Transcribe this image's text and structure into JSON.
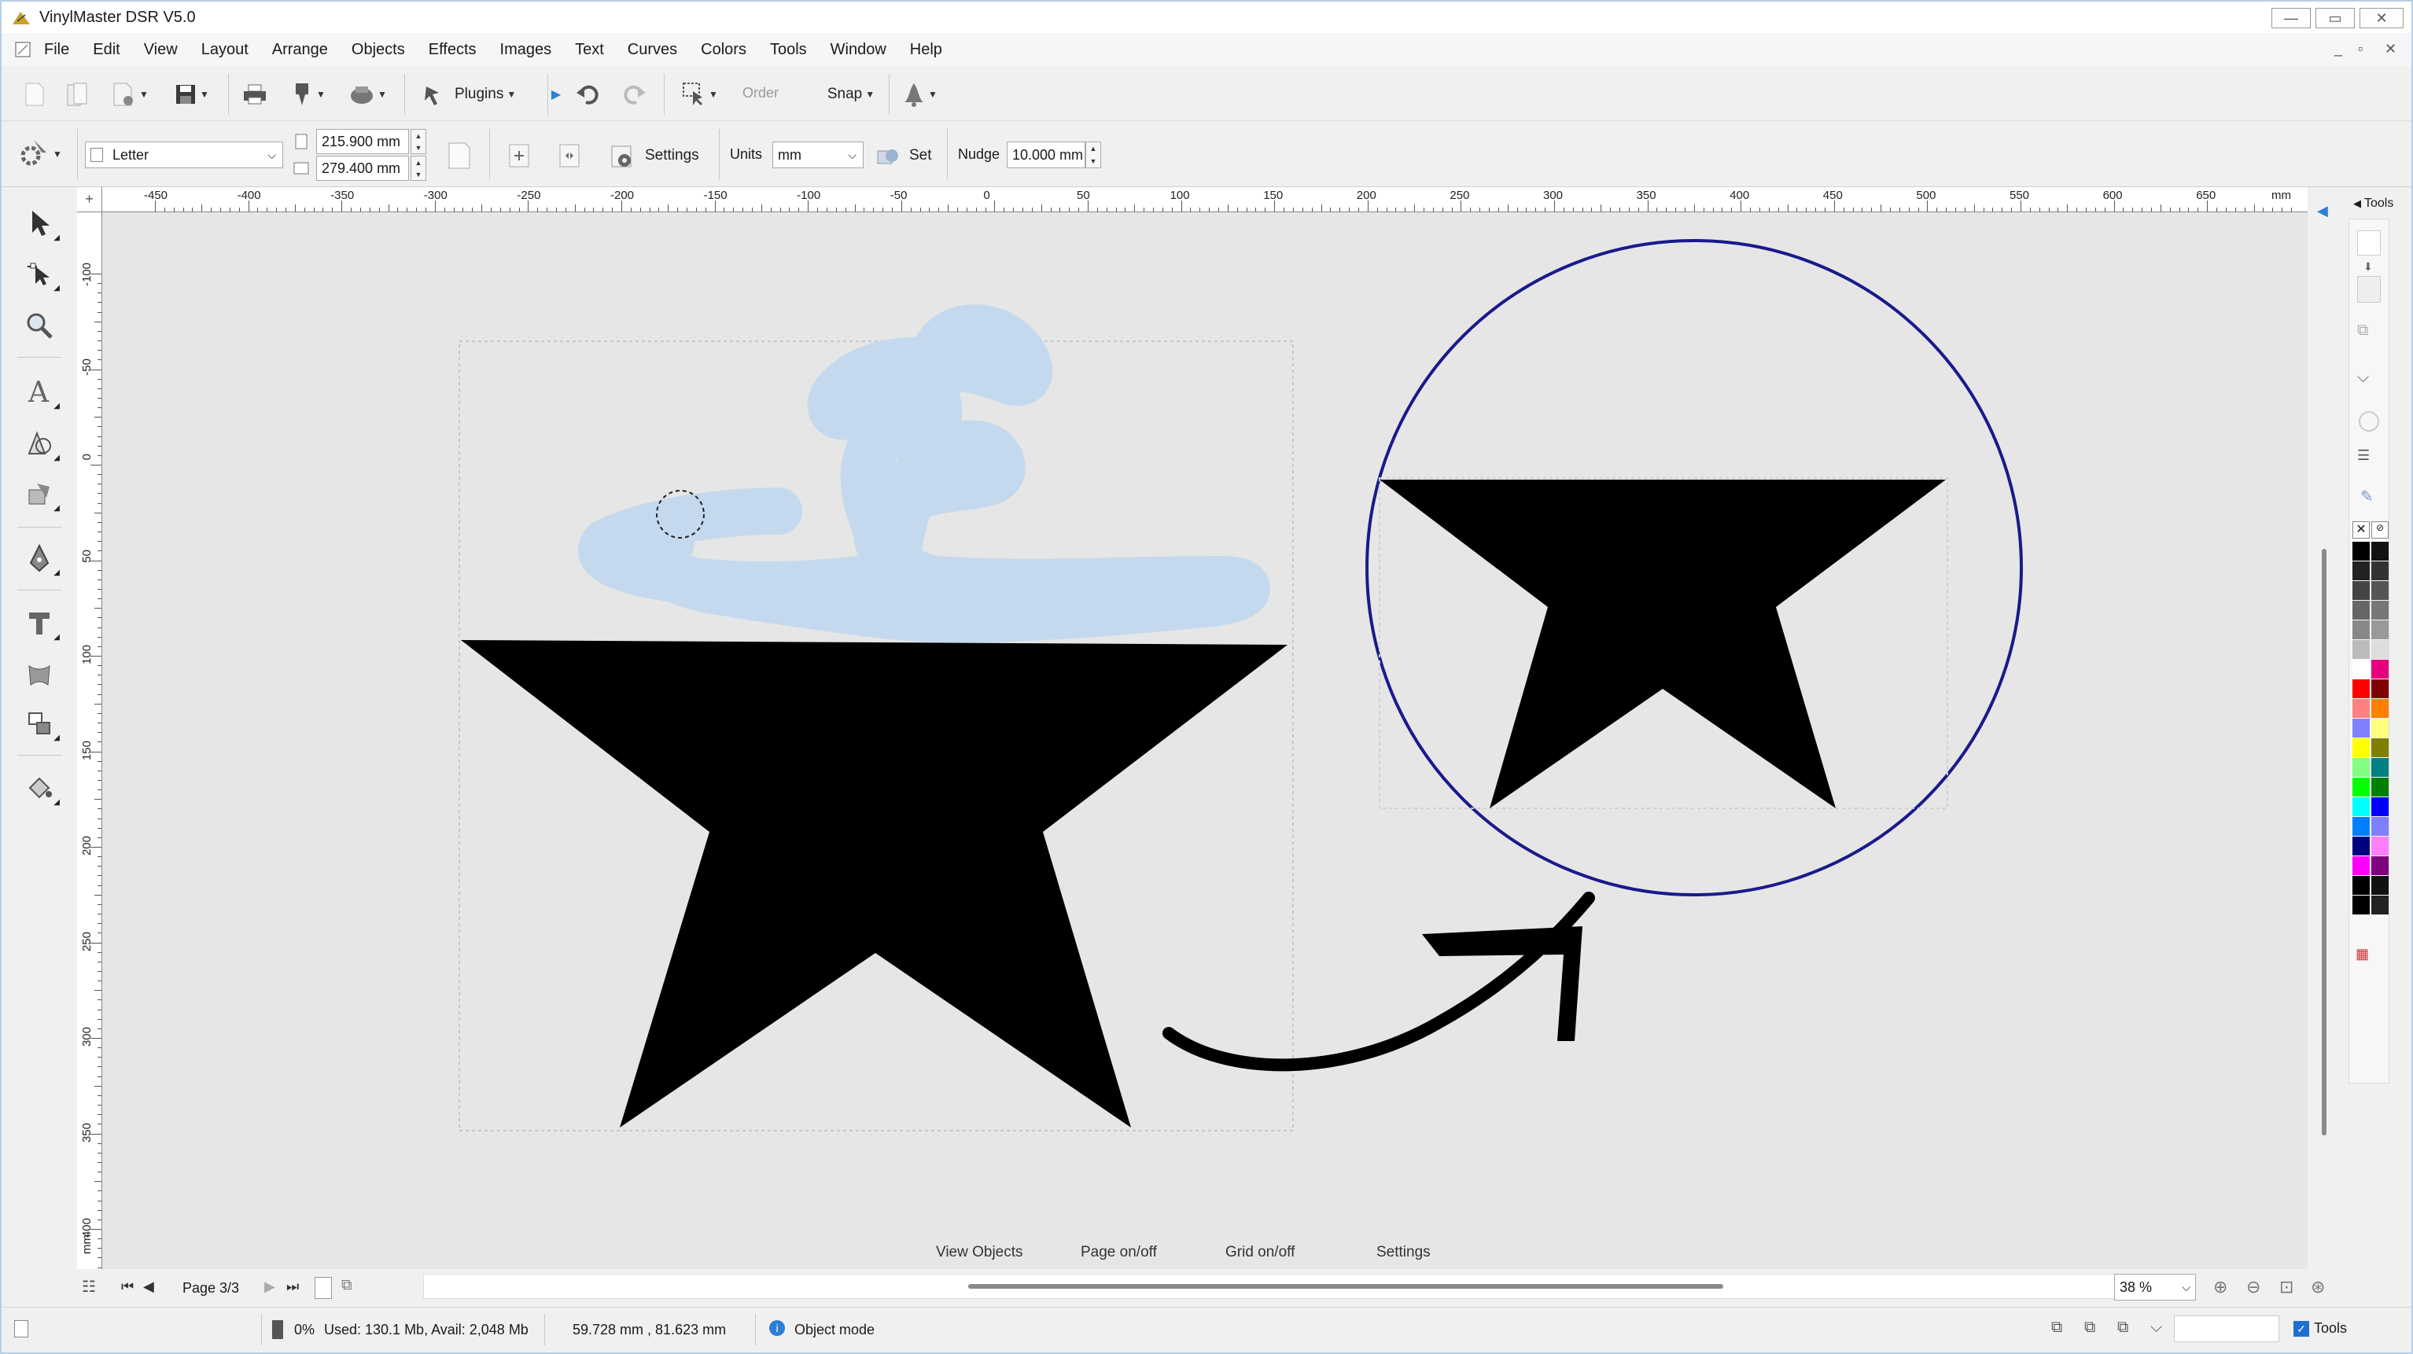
{
  "window": {
    "title": "VinylMaster DSR V5.0",
    "controls": [
      "minimize",
      "maximize",
      "close"
    ]
  },
  "menu": [
    "File",
    "Edit",
    "View",
    "Layout",
    "Arrange",
    "Objects",
    "Effects",
    "Images",
    "Text",
    "Curves",
    "Colors",
    "Tools",
    "Window",
    "Help"
  ],
  "toolbar": {
    "plugins_label": "Plugins",
    "order_label": "Order",
    "snap_label": "Snap"
  },
  "page_setup": {
    "page_size": "Letter",
    "width": "215.900 mm",
    "height": "279.400 mm",
    "settings_label": "Settings",
    "units_label": "Units",
    "units_value": "mm",
    "set_label": "Set",
    "nudge_label": "Nudge",
    "nudge_value": "10.000 mm"
  },
  "ruler": {
    "horizontal_ticks": [
      "-450",
      "-400",
      "-350",
      "-300",
      "-250",
      "-200",
      "-150",
      "-100",
      "-50",
      "0",
      "50",
      "100",
      "150",
      "200",
      "250",
      "300",
      "350",
      "400",
      "450",
      "500",
      "550",
      "600",
      "650"
    ],
    "horizontal_unit": "mm",
    "vertical_ticks": [
      "-100",
      "-50",
      "0",
      "50",
      "100",
      "150",
      "200",
      "250",
      "300",
      "350",
      "400"
    ],
    "vertical_unit": "mm"
  },
  "canvas_buttons": {
    "view_objects": "View Objects",
    "page_toggle": "Page on/off",
    "grid_toggle": "Grid on/off",
    "settings": "Settings"
  },
  "pager": {
    "page_label": "Page 3/3"
  },
  "zoom": {
    "value": "38 %"
  },
  "right_dock": {
    "tab_label": "Tools"
  },
  "status": {
    "percent": "0%",
    "memory": "Used: 130.1 Mb, Avail: 2,048 Mb",
    "coordinates": "59.728 mm , 81.623 mm",
    "mode": "Object mode",
    "tools_checkbox": "Tools"
  },
  "colors": {
    "title_border": "#b8cde6",
    "canvas_bg": "#e6e6e6",
    "scribble": "#c5d9ee",
    "star": "#000000",
    "circle": "#1a1a8c",
    "palette": [
      "#000000",
      "#111111",
      "#222222",
      "#333333",
      "#444444",
      "#555555",
      "#666666",
      "#777777",
      "#888888",
      "#999999",
      "#bbbbbb",
      "#dddddd",
      "#ffffff",
      "#e6007e",
      "#ff0000",
      "#800000",
      "#ff8080",
      "#ff8000",
      "#8080ff",
      "#ffff80",
      "#ffff00",
      "#808000",
      "#80ff80",
      "#008080",
      "#00ff00",
      "#008000",
      "#00ffff",
      "#0000ff",
      "#0080ff",
      "#8080ff",
      "#000080",
      "#ff80ff",
      "#ff00ff",
      "#800080",
      "#000000",
      "#111111",
      "#000000",
      "#222222"
    ]
  }
}
